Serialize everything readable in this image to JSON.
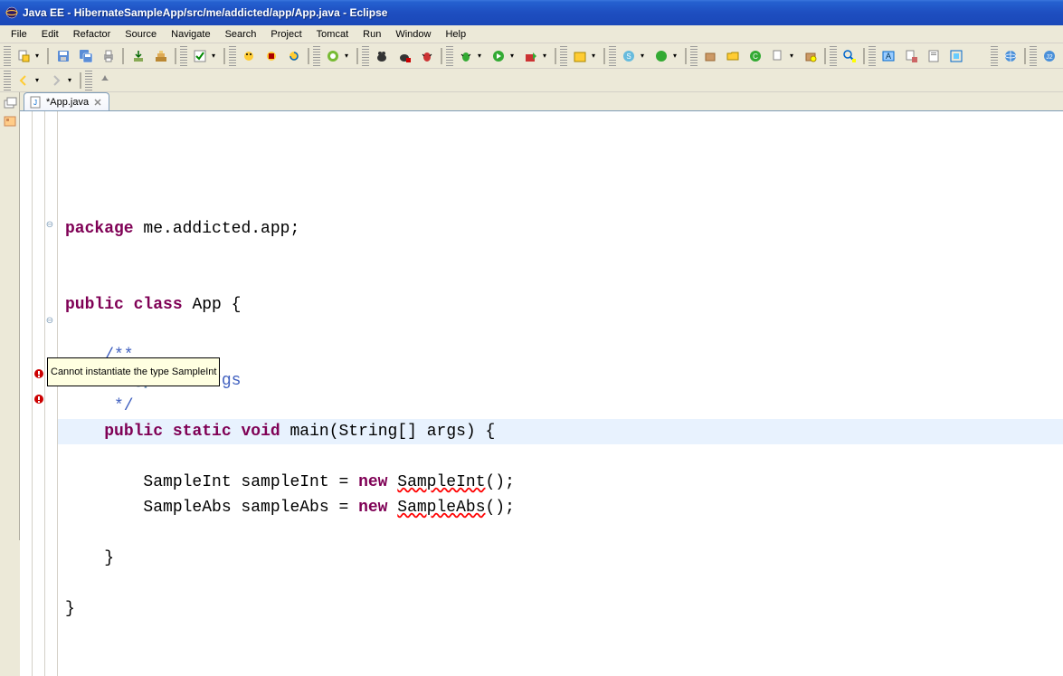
{
  "title": "Java EE - HibernateSampleApp/src/me/addicted/app/App.java - Eclipse",
  "menu": [
    "File",
    "Edit",
    "Refactor",
    "Source",
    "Navigate",
    "Search",
    "Project",
    "Tomcat",
    "Run",
    "Window",
    "Help"
  ],
  "tab": {
    "label": "*App.java"
  },
  "tooltip": "Cannot instantiate the type SampleInt",
  "code": {
    "l1_kw": "package",
    "l1_rest": " me.addicted.app;",
    "l3_kw1": "public",
    "l3_kw2": "class",
    "l3_rest": " App {",
    "l5": "    /**",
    "l6_a": "     * ",
    "l6_tag": "@param",
    "l6_b": " args",
    "l7": "     */",
    "l8_kw1": "public",
    "l8_kw2": "static",
    "l8_kw3": "void",
    "l8_rest": " main(String[] args) {",
    "l10_a": "        SampleInt sampleInt = ",
    "l10_kw": "new",
    "l10_b": " ",
    "l10_err": "SampleInt",
    "l10_c": "();",
    "l11_a": "        SampleAbs sampleAbs = ",
    "l11_kw": "new",
    "l11_b": " ",
    "l11_err": "SampleAbs",
    "l11_c": "();",
    "l13": "    }",
    "l15": "}"
  }
}
